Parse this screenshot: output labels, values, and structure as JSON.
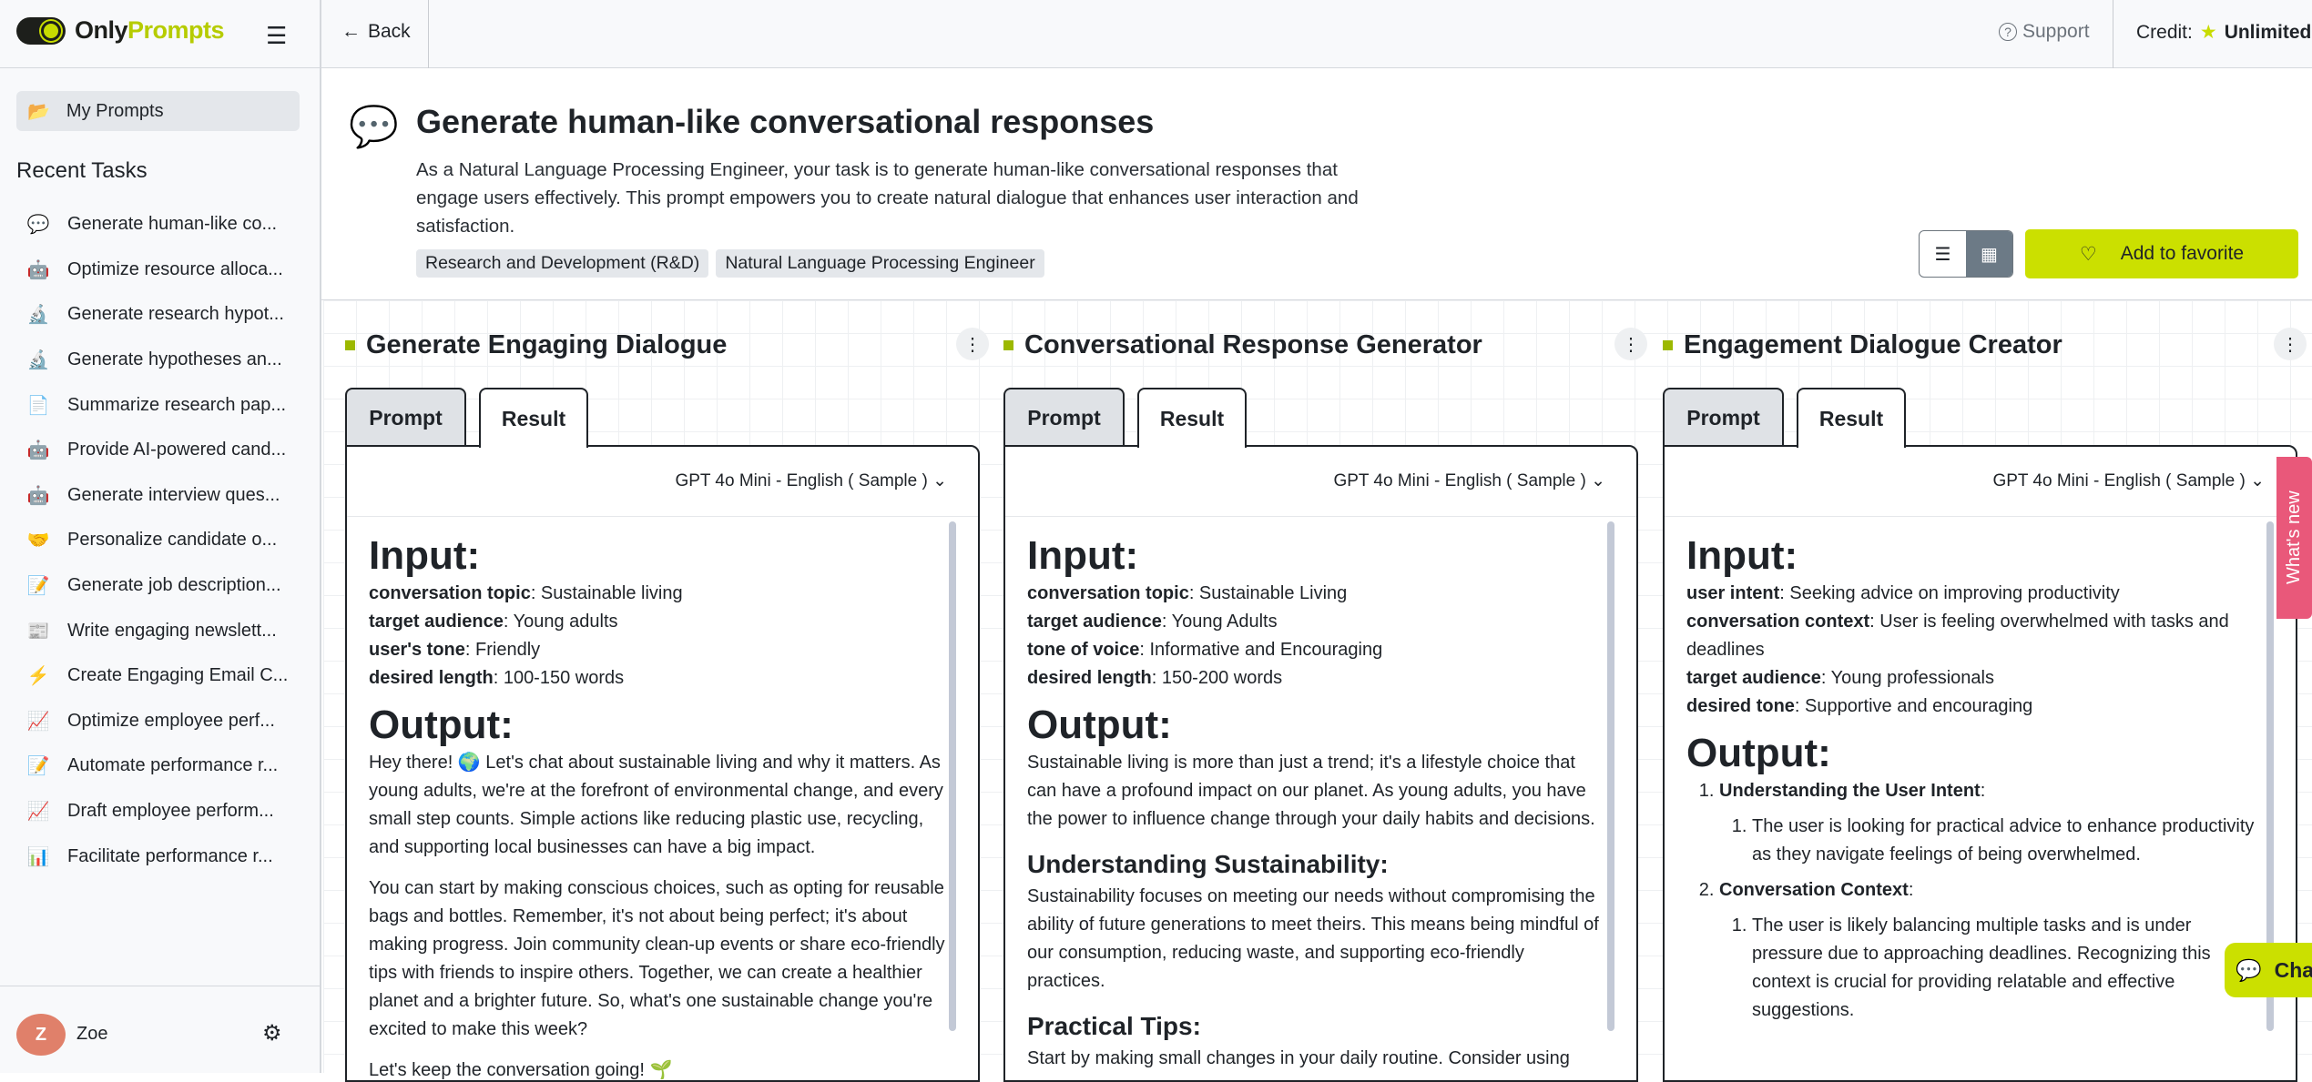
{
  "brand": {
    "name_a": "Only",
    "name_b": "Prompts",
    "accent": "#cbe000"
  },
  "sidebar": {
    "my_prompts": "My Prompts",
    "recent_title": "Recent Tasks",
    "tasks": [
      {
        "icon": "💬",
        "label": "Generate human-like co..."
      },
      {
        "icon": "🤖",
        "label": "Optimize resource alloca..."
      },
      {
        "icon": "🔬",
        "label": "Generate research hypot..."
      },
      {
        "icon": "🔬",
        "label": "Generate hypotheses an..."
      },
      {
        "icon": "📄",
        "label": "Summarize research pap..."
      },
      {
        "icon": "🤖",
        "label": "Provide AI-powered cand..."
      },
      {
        "icon": "🤖",
        "label": "Generate interview ques..."
      },
      {
        "icon": "🤝",
        "label": "Personalize candidate o..."
      },
      {
        "icon": "📝",
        "label": "Generate job description..."
      },
      {
        "icon": "📰",
        "label": "Write engaging newslett..."
      },
      {
        "icon": "⚡",
        "label": "Create Engaging Email C..."
      },
      {
        "icon": "📈",
        "label": "Optimize employee perf..."
      },
      {
        "icon": "📝",
        "label": "Automate performance r..."
      },
      {
        "icon": "📈",
        "label": "Draft employee perform..."
      },
      {
        "icon": "📊",
        "label": "Facilitate performance r..."
      }
    ],
    "user": {
      "initial": "Z",
      "name": "Zoe"
    }
  },
  "topbar": {
    "back": "Back",
    "support": "Support",
    "credit_label": "Credit:",
    "credit_value": "Unlimited"
  },
  "header": {
    "title": "Generate human-like conversational responses",
    "description": "As a Natural Language Processing Engineer, your task is to generate human-like conversational responses that engage users effectively. This prompt empowers you to create natural dialogue that enhances user interaction and satisfaction.",
    "tags": [
      "Research and Development (R&D)",
      "Natural Language Processing Engineer"
    ],
    "favorite": "Add to favorite"
  },
  "tabs": {
    "prompt": "Prompt",
    "result": "Result"
  },
  "model": "GPT 4o Mini - English ( Sample )",
  "labels": {
    "input": "Input:",
    "output": "Output:"
  },
  "columns": [
    {
      "title": "Generate Engaging Dialogue",
      "inputs": [
        [
          "conversation topic",
          ": Sustainable living"
        ],
        [
          "target audience",
          ": Young adults"
        ],
        [
          "user's tone",
          ": Friendly"
        ],
        [
          "desired length",
          ": 100-150 words"
        ]
      ],
      "output": [
        "Hey there! 🌍 Let's chat about sustainable living and why it matters. As young adults, we're at the forefront of environmental change, and every small step counts. Simple actions like reducing plastic use, recycling, and supporting local businesses can have a big impact.",
        "You can start by making conscious choices, such as opting for reusable bags and bottles. Remember, it's not about being perfect; it's about making progress. Join community clean-up events or share eco-friendly tips with friends to inspire others. Together, we can create a healthier planet and a brighter future. So, what's one sustainable change you're excited to make this week?",
        "Let's keep the conversation going! 🌱"
      ]
    },
    {
      "title": "Conversational Response Generator",
      "inputs": [
        [
          "conversation topic",
          ": Sustainable Living"
        ],
        [
          "target audience",
          ": Young Adults"
        ],
        [
          "tone of voice",
          ": Informative and Encouraging"
        ],
        [
          "desired length",
          ": 150-200 words"
        ]
      ],
      "output": [
        "Sustainable living is more than just a trend; it's a lifestyle choice that can have a profound impact on our planet. As young adults, you have the power to influence change through your daily habits and decisions."
      ],
      "sections": [
        {
          "heading": "Understanding Sustainability:",
          "text": "Sustainability focuses on meeting our needs without compromising the ability of future generations to meet theirs. This means being mindful of our consumption, reducing waste, and supporting eco-friendly practices."
        },
        {
          "heading": "Practical Tips:",
          "text": "Start by making small changes in your daily routine. Consider using"
        }
      ]
    },
    {
      "title": "Engagement Dialogue Creator",
      "inputs": [
        [
          "user intent",
          ": Seeking advice on improving productivity"
        ],
        [
          "conversation context",
          ": User is feeling overwhelmed with tasks and deadlines"
        ],
        [
          "target audience",
          ": Young professionals"
        ],
        [
          "desired tone",
          ": Supportive and encouraging"
        ]
      ],
      "list": [
        {
          "heading": "Understanding the User Intent",
          "items": [
            "The user is looking for practical advice to enhance productivity as they navigate feelings of being overwhelmed."
          ]
        },
        {
          "heading": "Conversation Context",
          "items": [
            "The user is likely balancing multiple tasks and is under pressure due to approaching deadlines. Recognizing this context is crucial for providing relatable and effective suggestions."
          ]
        }
      ]
    }
  ],
  "floating": {
    "whats_new": "What's new",
    "chat": "Chat"
  }
}
